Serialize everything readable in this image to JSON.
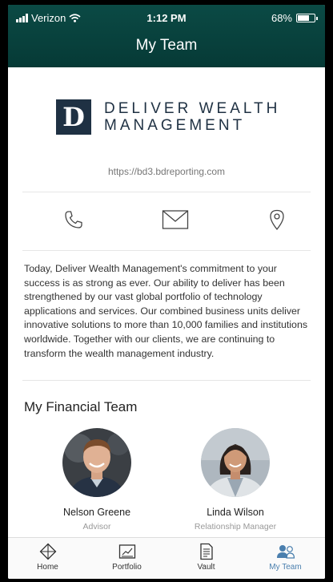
{
  "status_bar": {
    "carrier": "Verizon",
    "time": "1:12 PM",
    "battery": "68%",
    "battery_level": 0.68
  },
  "header": {
    "title": "My Team"
  },
  "firm": {
    "logo_letter": "D",
    "logo_line1": "DELIVER WEALTH",
    "logo_line2": "MANAGEMENT",
    "url": "https://bd3.bdreporting.com"
  },
  "contact_icons": [
    "phone-icon",
    "mail-icon",
    "location-pin-icon"
  ],
  "about": "Today, Deliver Wealth Management's commitment to your success is as strong as ever. Our ability to deliver has been strengthened by our vast global portfolio of technology applications and services. Our combined business units deliver innovative solutions to more than 10,000 families and institutions worldwide. Together with our clients, we are continuing to transform the wealth management industry.",
  "team": {
    "heading": "My Financial Team",
    "members": [
      {
        "name": "Nelson Greene",
        "role": "Advisor"
      },
      {
        "name": "Linda Wilson",
        "role": "Relationship Manager"
      }
    ]
  },
  "tabs": [
    {
      "label": "Home",
      "icon": "diamond-compass-icon"
    },
    {
      "label": "Portfolio",
      "icon": "chart-icon"
    },
    {
      "label": "Vault",
      "icon": "document-icon"
    },
    {
      "label": "My Team",
      "icon": "people-icon",
      "active": true
    }
  ],
  "colors": {
    "header": "#063a36",
    "accent": "#4a7fae",
    "logo": "#1f3143"
  }
}
